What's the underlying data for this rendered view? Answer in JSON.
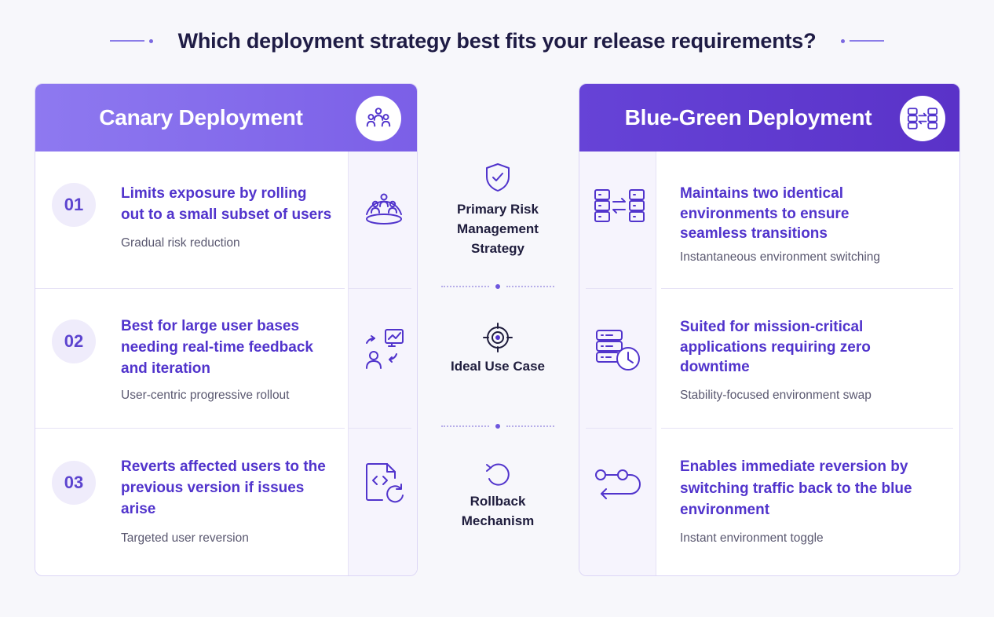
{
  "title": "Which deployment strategy best fits your release requirements?",
  "colors": {
    "accent": "#5134cc",
    "canary_header": "#8e79f0",
    "bluegreen_header": "#5a32c8"
  },
  "criteria": [
    {
      "label": "Primary Risk Management Strategy",
      "icon": "shield-check-icon"
    },
    {
      "label": "Ideal Use Case",
      "icon": "target-icon"
    },
    {
      "label": "Rollback Mechanism",
      "icon": "rollback-icon"
    }
  ],
  "canary": {
    "title": "Canary Deployment",
    "header_icon": "user-group-icon",
    "rows": [
      {
        "num": "01",
        "title": "Limits exposure by rolling out to a small subset of users",
        "subtitle": "Gradual risk reduction",
        "icon": "user-subset-icon"
      },
      {
        "num": "02",
        "title": "Best for large user bases needing real-time feedback and iteration",
        "subtitle": "User-centric progressive rollout",
        "icon": "feedback-loop-icon"
      },
      {
        "num": "03",
        "title": "Reverts affected users to the previous version if issues arise",
        "subtitle": "Targeted user reversion",
        "icon": "code-revert-icon"
      }
    ]
  },
  "bluegreen": {
    "title": "Blue-Green Deployment",
    "header_icon": "server-swap-icon",
    "rows": [
      {
        "title": "Maintains two identical environments to ensure seamless transitions",
        "subtitle": "Instantaneous environment switching",
        "icon": "server-swap-icon"
      },
      {
        "title": "Suited for mission-critical applications requiring zero downtime",
        "subtitle": "Stability-focused environment swap",
        "icon": "server-clock-icon"
      },
      {
        "title": "Enables immediate reversion by switching traffic back to the blue environment",
        "subtitle": "Instant environment toggle",
        "icon": "traffic-back-icon"
      }
    ]
  }
}
